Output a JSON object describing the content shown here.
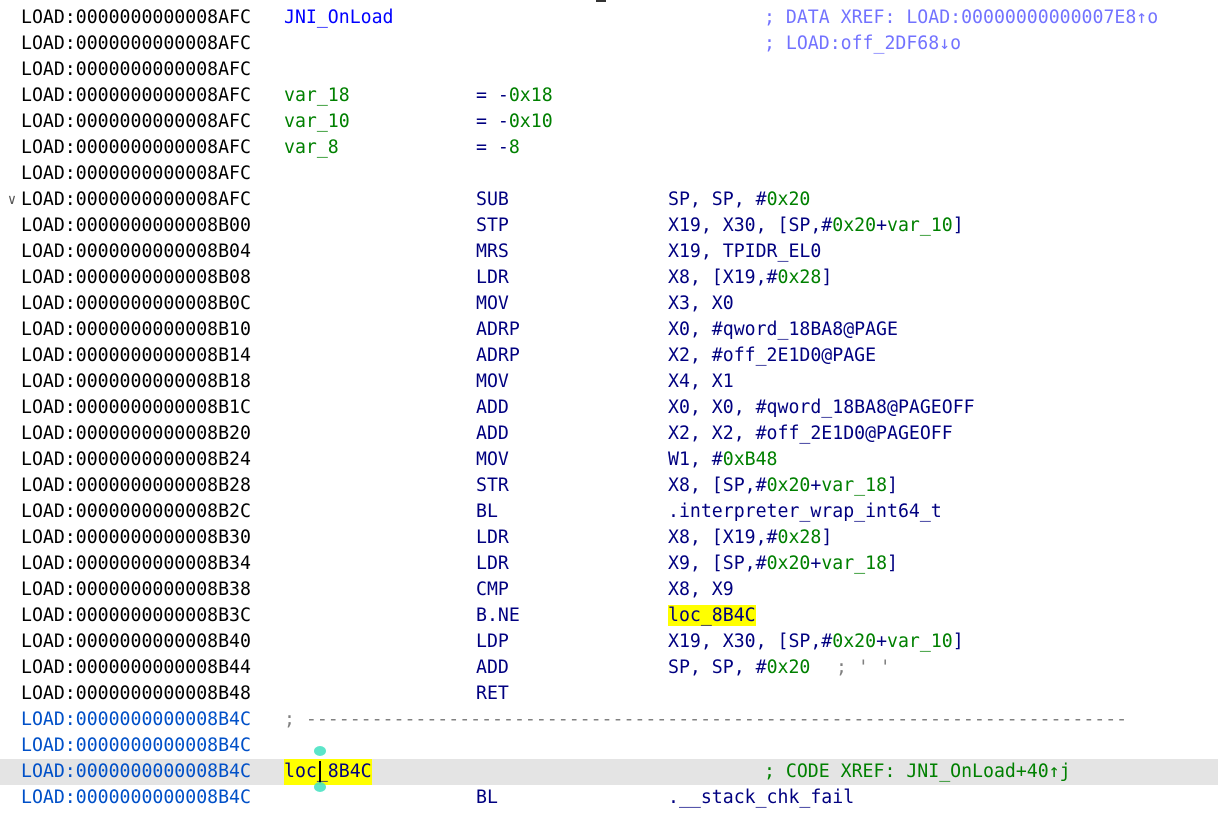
{
  "listing": {
    "rows": [
      {
        "addr": "LOAD:0000000000008AFC",
        "label": "JNI_OnLoad",
        "comment": "; DATA XREF: LOAD:00000000000007E8↑o"
      },
      {
        "addr": "LOAD:0000000000008AFC",
        "comment": "; LOAD:off_2DF68↓o"
      },
      {
        "addr": "LOAD:0000000000008AFC"
      },
      {
        "addr": "LOAD:0000000000008AFC",
        "var": "var_18",
        "eq": "= -0x18"
      },
      {
        "addr": "LOAD:0000000000008AFC",
        "var": "var_10",
        "eq": "= -0x10"
      },
      {
        "addr": "LOAD:0000000000008AFC",
        "var": "var_8",
        "eq": "= -8"
      },
      {
        "addr": "LOAD:0000000000008AFC"
      },
      {
        "addr": "LOAD:0000000000008AFC",
        "mnem": "SUB",
        "ops": "SP, SP, #0x20"
      },
      {
        "addr": "LOAD:0000000000008B00",
        "mnem": "STP",
        "ops": "X19, X30, [SP,#0x20+var_10]"
      },
      {
        "addr": "LOAD:0000000000008B04",
        "mnem": "MRS",
        "ops": "X19, TPIDR_EL0"
      },
      {
        "addr": "LOAD:0000000000008B08",
        "mnem": "LDR",
        "ops": "X8, [X19,#0x28]"
      },
      {
        "addr": "LOAD:0000000000008B0C",
        "mnem": "MOV",
        "ops": "X3, X0"
      },
      {
        "addr": "LOAD:0000000000008B10",
        "mnem": "ADRP",
        "ops": "X0, #qword_18BA8@PAGE"
      },
      {
        "addr": "LOAD:0000000000008B14",
        "mnem": "ADRP",
        "ops": "X2, #off_2E1D0@PAGE"
      },
      {
        "addr": "LOAD:0000000000008B18",
        "mnem": "MOV",
        "ops": "X4, X1"
      },
      {
        "addr": "LOAD:0000000000008B1C",
        "mnem": "ADD",
        "ops": "X0, X0, #qword_18BA8@PAGEOFF"
      },
      {
        "addr": "LOAD:0000000000008B20",
        "mnem": "ADD",
        "ops": "X2, X2, #off_2E1D0@PAGEOFF"
      },
      {
        "addr": "LOAD:0000000000008B24",
        "mnem": "MOV",
        "ops": "W1, #0xB48"
      },
      {
        "addr": "LOAD:0000000000008B28",
        "mnem": "STR",
        "ops": "X8, [SP,#0x20+var_18]"
      },
      {
        "addr": "LOAD:0000000000008B2C",
        "mnem": "BL",
        "ops": ".interpreter_wrap_int64_t"
      },
      {
        "addr": "LOAD:0000000000008B30",
        "mnem": "LDR",
        "ops": "X8, [X19,#0x28]"
      },
      {
        "addr": "LOAD:0000000000008B34",
        "mnem": "LDR",
        "ops": "X9, [SP,#0x20+var_18]"
      },
      {
        "addr": "LOAD:0000000000008B38",
        "mnem": "CMP",
        "ops": "X8, X9"
      },
      {
        "addr": "LOAD:0000000000008B3C",
        "mnem": "B.NE",
        "ops": "loc_8B4C"
      },
      {
        "addr": "LOAD:0000000000008B40",
        "mnem": "LDP",
        "ops": "X19, X30, [SP,#0x20+var_10]"
      },
      {
        "addr": "LOAD:0000000000008B44",
        "mnem": "ADD",
        "ops": "SP, SP, #0x20",
        "inline_comment": "; ' '"
      },
      {
        "addr": "LOAD:0000000000008B48",
        "mnem": "RET"
      },
      {
        "addr": "LOAD:0000000000008B4C",
        "separator": "; ---------------------------------------------------------------------------"
      },
      {
        "addr": "LOAD:0000000000008B4C"
      },
      {
        "addr": "LOAD:0000000000008B4C",
        "cursor_label": "loc_8B4C",
        "comment": "; CODE XREF: JNI_OnLoad+40↑j"
      },
      {
        "addr": "LOAD:0000000000008B4C",
        "mnem": "BL",
        "ops": ".__stack_chk_fail"
      }
    ]
  },
  "colors": {
    "background": "#ffffff",
    "address": "#000000",
    "address_blue": "#0050c8",
    "instruction": "#000080",
    "number": "#008000",
    "highlight": "#ffff00",
    "current_line": "#e4e4e4"
  },
  "icons": {
    "fold": "chevron-down-icon"
  }
}
